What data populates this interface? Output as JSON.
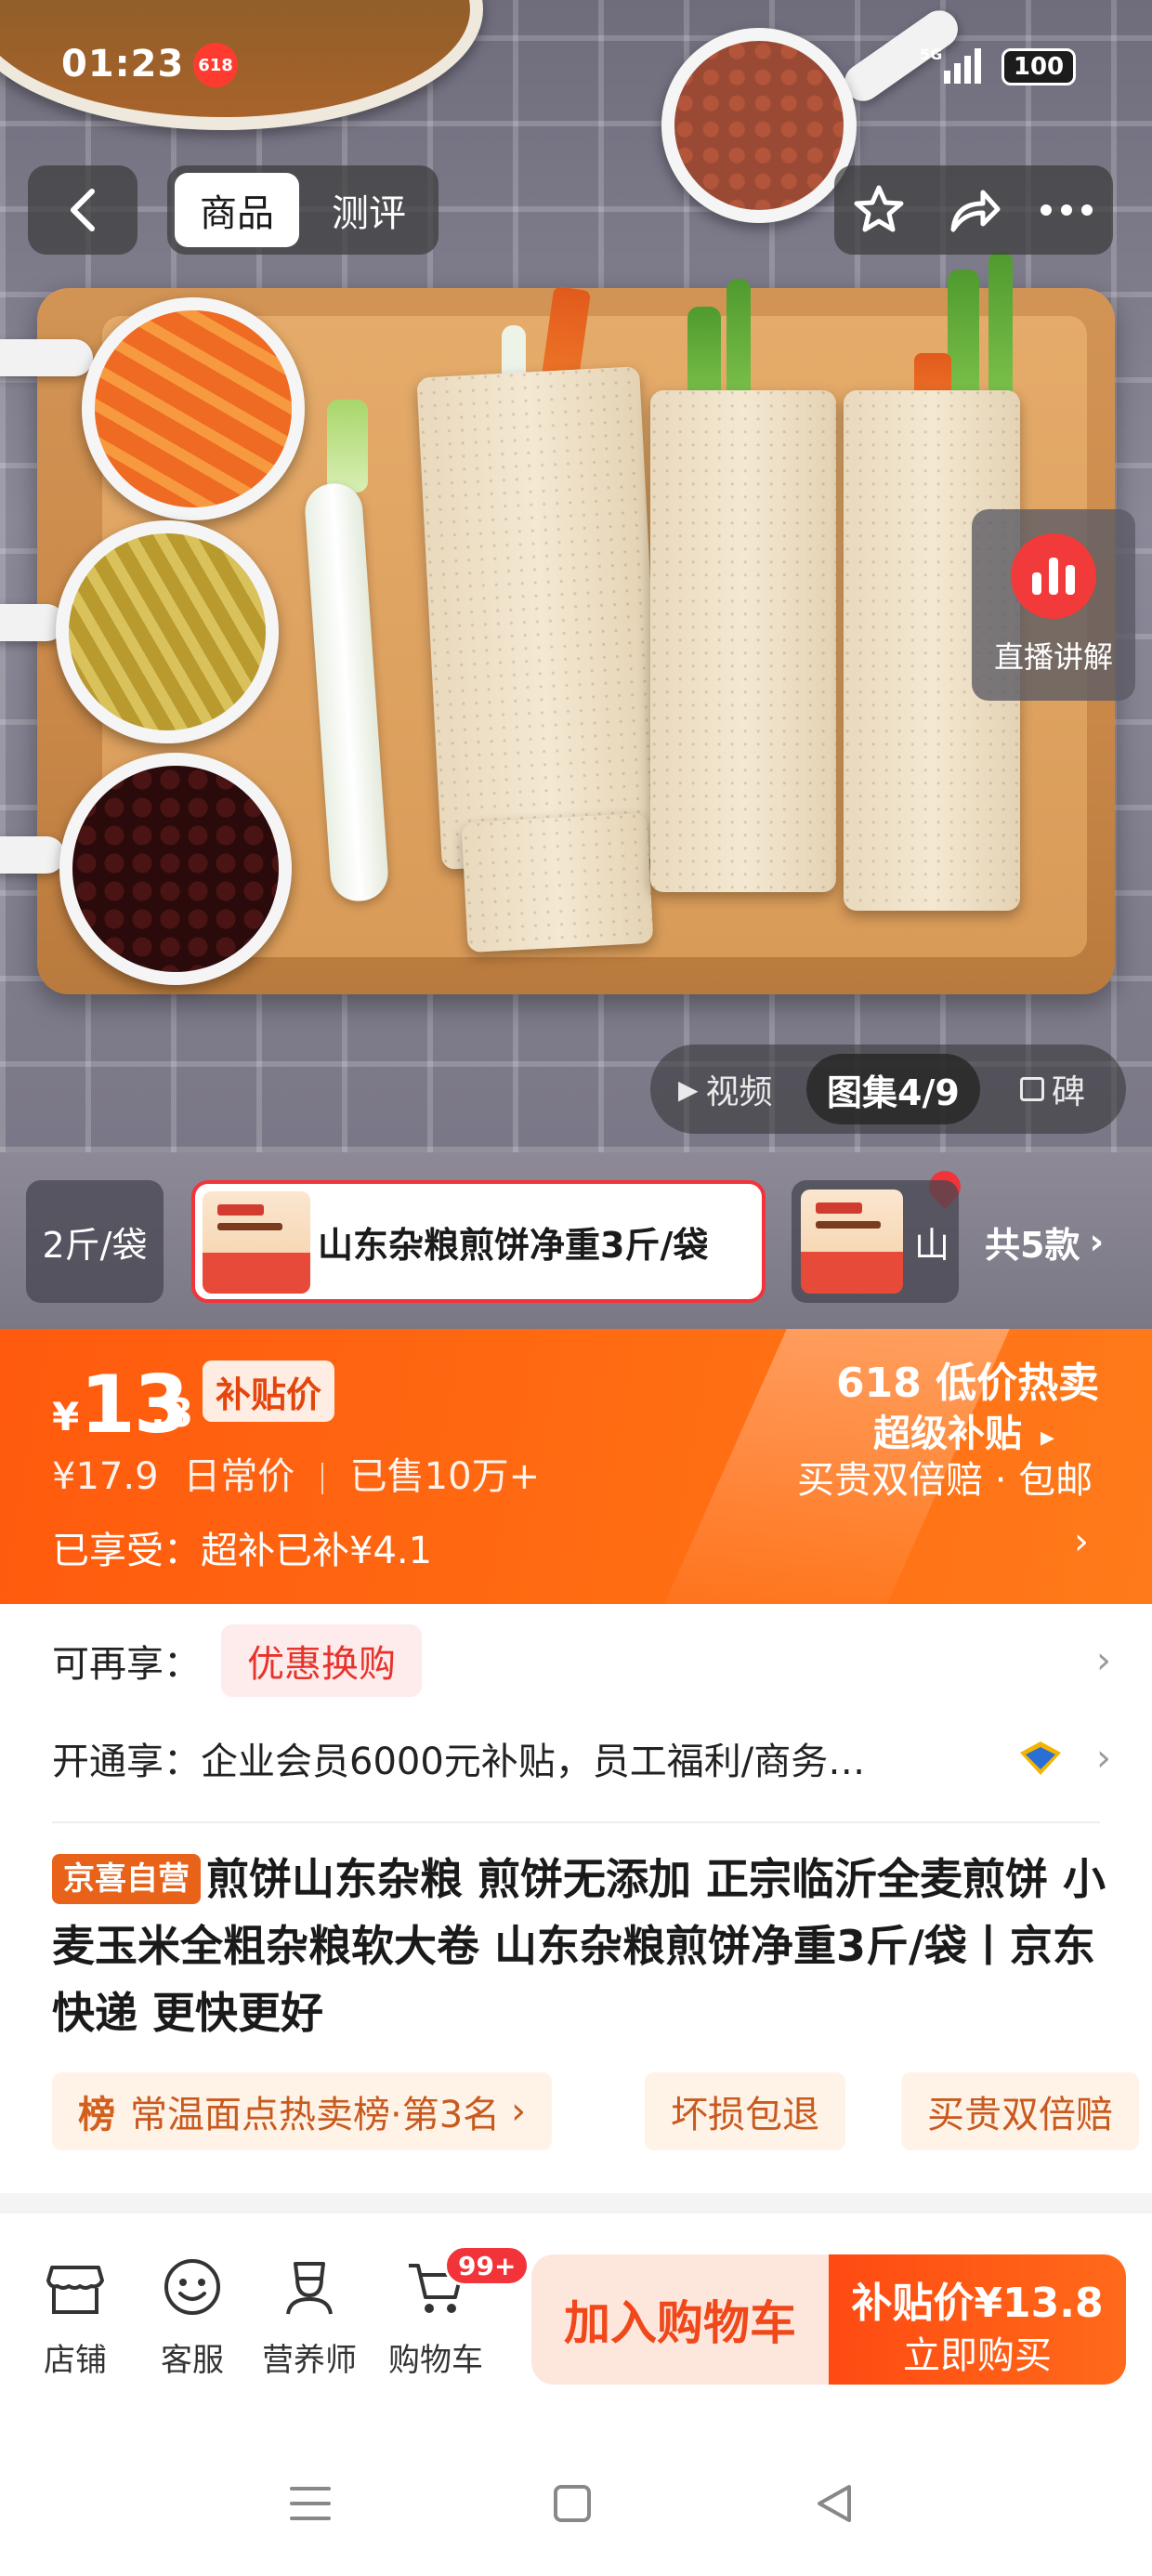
{
  "status_bar": {
    "time": "01:23",
    "badge": "618",
    "network": "5G",
    "battery": "100"
  },
  "nav": {
    "tabs": [
      {
        "label": "商品"
      },
      {
        "label": "测评"
      }
    ]
  },
  "live": {
    "label": "直播讲解"
  },
  "media": {
    "video_label": "视频",
    "gallery_label": "图集4/9",
    "other_label": "碑"
  },
  "variants": {
    "left_label": "2斤/袋",
    "selected_label": "山东杂粮煎饼净重3斤/袋",
    "right_label": "山",
    "count_label": "共5款"
  },
  "price": {
    "currency": "¥",
    "integer": "13",
    "decimal": ".8",
    "tag": "补贴价",
    "original": "¥17.9",
    "original_label": "日常价",
    "sold": "已售10万+",
    "enjoyed": "已享受：超补已补¥4.1"
  },
  "promo": {
    "title": "618 低价热卖",
    "subtitle": "超级补贴",
    "note": "买贵双倍赔 · 包邮"
  },
  "benefits": {
    "more_label": "可再享：",
    "more_pill": "优惠换购",
    "open_label": "开通享：",
    "open_text": "企业会员6000元补贴，员工福利/商务…"
  },
  "product": {
    "self_tag": "京喜自营",
    "title": "煎饼山东杂粮 煎饼无添加 正宗临沂全麦煎饼 小麦玉米全粗杂粮软大卷 山东杂粮煎饼净重3斤/袋丨京东快递 更快更好"
  },
  "chips": {
    "rank_mark": "榜",
    "rank_label": "常温面点热卖榜·第3名",
    "damage": "坏损包退",
    "double": "买贵双倍赔"
  },
  "bottom_bar": {
    "items": [
      {
        "label": "店铺"
      },
      {
        "label": "客服"
      },
      {
        "label": "营养师"
      },
      {
        "label": "购物车",
        "badge": "99+"
      }
    ],
    "add_cart": "加入购物车",
    "buy_top": "补贴价¥13.8",
    "buy_bottom": "立即购买"
  },
  "colors": {
    "brand_orange": "#ff5a0e",
    "accent_red": "#f2343a",
    "pill_red": "#e8332c"
  }
}
